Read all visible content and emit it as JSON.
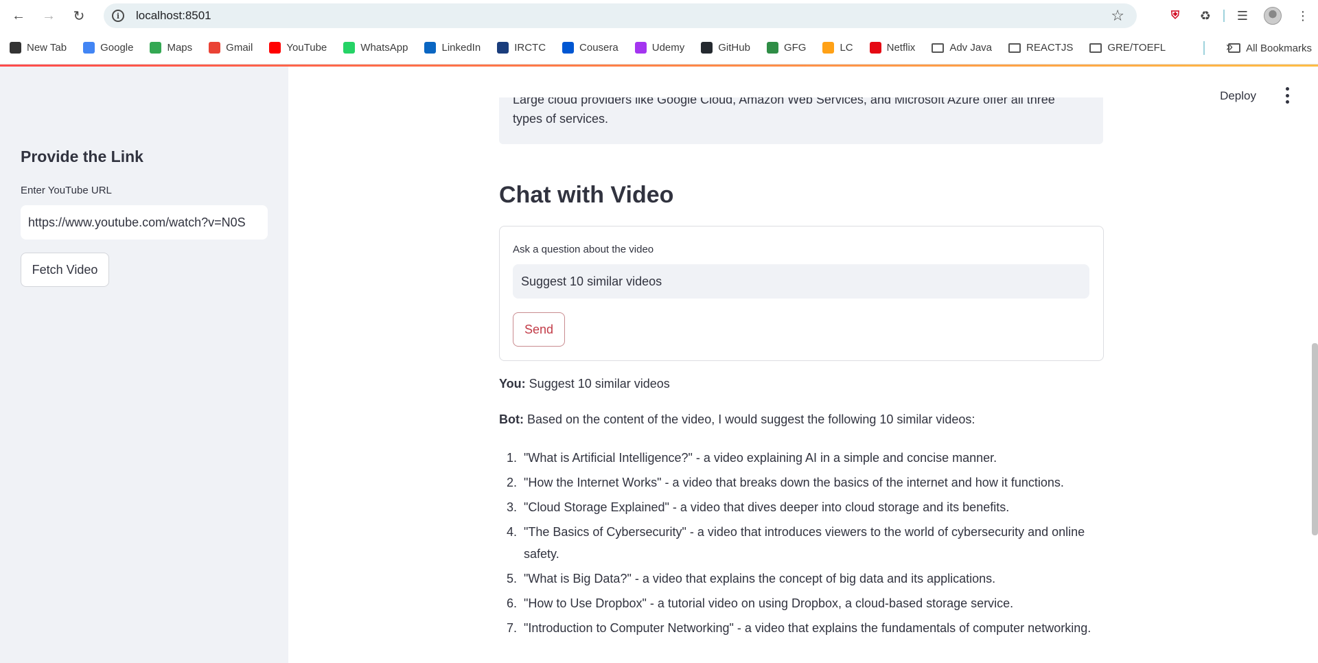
{
  "browser": {
    "url": "localhost:8501",
    "bookmarks": [
      {
        "label": "New Tab",
        "icon": "globe-icon",
        "color": "#333333"
      },
      {
        "label": "Google",
        "icon": "google-icon",
        "color": "#4285f4"
      },
      {
        "label": "Maps",
        "icon": "maps-icon",
        "color": "#34a853"
      },
      {
        "label": "Gmail",
        "icon": "gmail-icon",
        "color": "#ea4335"
      },
      {
        "label": "YouTube",
        "icon": "youtube-icon",
        "color": "#ff0000"
      },
      {
        "label": "WhatsApp",
        "icon": "whatsapp-icon",
        "color": "#25d366"
      },
      {
        "label": "LinkedIn",
        "icon": "linkedin-icon",
        "color": "#0a66c2"
      },
      {
        "label": "IRCTC",
        "icon": "irctc-icon",
        "color": "#1a3d7c"
      },
      {
        "label": "Cousera",
        "icon": "coursera-icon",
        "color": "#0056d2"
      },
      {
        "label": "Udemy",
        "icon": "udemy-icon",
        "color": "#a435f0"
      },
      {
        "label": "GitHub",
        "icon": "github-icon",
        "color": "#24292f"
      },
      {
        "label": "GFG",
        "icon": "gfg-icon",
        "color": "#2f8d46"
      },
      {
        "label": "LC",
        "icon": "leetcode-icon",
        "color": "#ffa116"
      },
      {
        "label": "Netflix",
        "icon": "netflix-icon",
        "color": "#e50914"
      },
      {
        "label": "Adv Java",
        "icon": "folder-icon",
        "color": ""
      },
      {
        "label": "REACTJS",
        "icon": "folder-icon",
        "color": ""
      },
      {
        "label": "GRE/TOEFL",
        "icon": "folder-icon",
        "color": ""
      }
    ],
    "more": "»",
    "all_bookmarks": "All Bookmarks"
  },
  "sidebar": {
    "title": "Provide the Link",
    "url_label": "Enter YouTube URL",
    "url_value": "https://www.youtube.com/watch?v=N0S",
    "fetch_button": "Fetch Video"
  },
  "header": {
    "deploy": "Deploy"
  },
  "summary": {
    "line1": "Large cloud providers like Google Cloud, Amazon Web Services, and Microsoft Azure offer all three",
    "line2": "types of services."
  },
  "chat": {
    "title": "Chat with Video",
    "question_label": "Ask a question about the video",
    "question_value": "Suggest 10 similar videos",
    "send_button": "Send",
    "you_label": "You:",
    "you_text": "Suggest 10 similar videos",
    "bot_label": "Bot:",
    "bot_text": "Based on the content of the video, I would suggest the following 10 similar videos:",
    "suggestions": [
      {
        "num": "1.",
        "text": "\"What is Artificial Intelligence?\" - a video explaining AI in a simple and concise manner."
      },
      {
        "num": "2.",
        "text": "\"How the Internet Works\" - a video that breaks down the basics of the internet and how it functions."
      },
      {
        "num": "3.",
        "text": "\"Cloud Storage Explained\" - a video that dives deeper into cloud storage and its benefits."
      },
      {
        "num": "4.",
        "text": "\"The Basics of Cybersecurity\" - a video that introduces viewers to the world of cybersecurity and online safety."
      },
      {
        "num": "5.",
        "text": "\"What is Big Data?\" - a video that explains the concept of big data and its applications."
      },
      {
        "num": "6.",
        "text": "\"How to Use Dropbox\" - a tutorial video on using Dropbox, a cloud-based storage service."
      },
      {
        "num": "7.",
        "text": "\"Introduction to Computer Networking\" - a video that explains the fundamentals of computer networking."
      }
    ]
  },
  "colors": {
    "accent": "#ff4b4b",
    "send_text": "#c23b47",
    "sidebar_bg": "#f0f2f6"
  }
}
